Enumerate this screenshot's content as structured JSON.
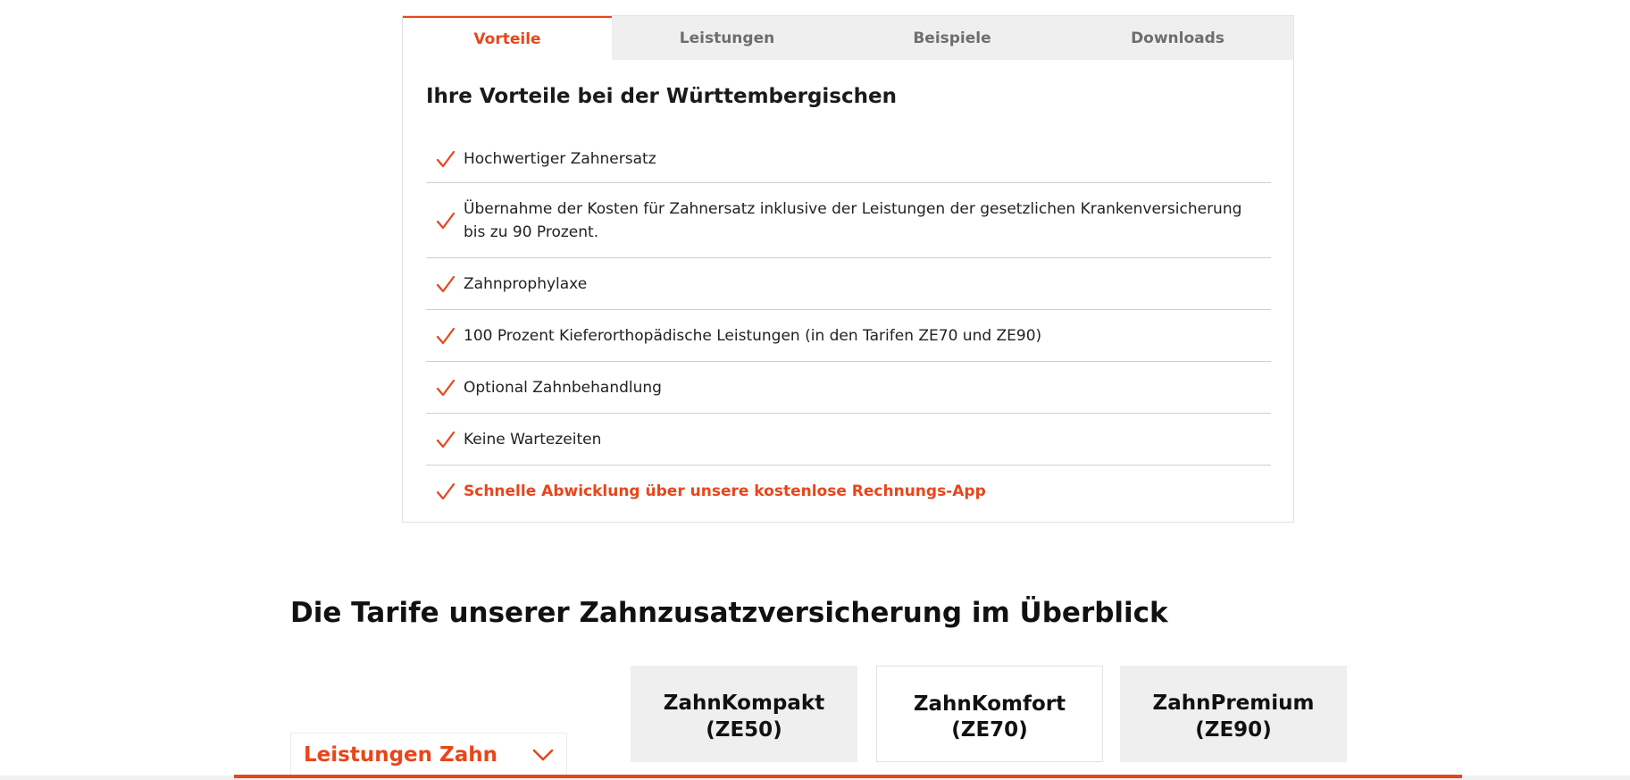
{
  "tabs": [
    {
      "label": "Vorteile",
      "active": true
    },
    {
      "label": "Leistungen",
      "active": false
    },
    {
      "label": "Beispiele",
      "active": false
    },
    {
      "label": "Downloads",
      "active": false
    }
  ],
  "advantages": {
    "title": "Ihre Vorteile bei der Württembergischen",
    "items": [
      "Hochwertiger Zahnersatz",
      "Übernahme der Kosten für Zahnersatz inklusive der Leistungen der gesetzlichen Krankenversicherung bis zu 90 Prozent.",
      "Zahnprophylaxe",
      "100 Prozent Kieferorthopädische Leistungen (in den Tarifen ZE70 und ZE90)",
      "Optional Zahnbehandlung",
      "Keine Wartezeiten",
      "Schnelle Abwicklung über unsere kostenlose Rechnungs-App"
    ],
    "icon": "checkmark-icon"
  },
  "overview": {
    "title": "Die Tarife unserer Zahnzusatzversicherung im Überblick",
    "tariffs": [
      {
        "name": "ZahnKompakt",
        "code": "(ZE50)"
      },
      {
        "name": "ZahnKomfort",
        "code": "(ZE70)"
      },
      {
        "name": "ZahnPremium",
        "code": "(ZE90)"
      }
    ],
    "accordion": {
      "label": "Leistungen Zahn",
      "icon": "chevron-down-icon"
    }
  },
  "colors": {
    "accent": "#e8461b",
    "tab_inactive_bg": "#efefef",
    "text": "#222222",
    "divider": "#cfcfcf"
  }
}
